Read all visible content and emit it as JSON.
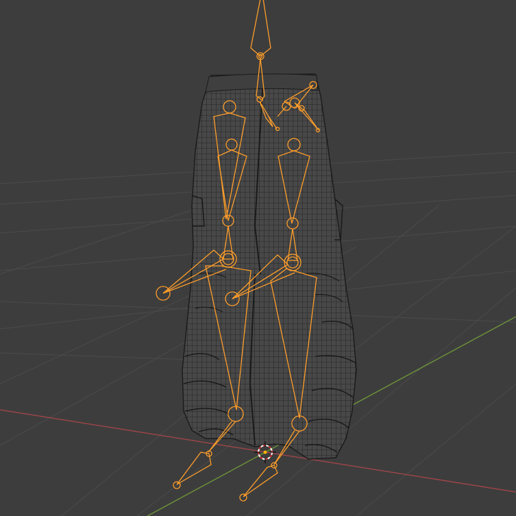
{
  "viewport": {
    "name": "3D Viewport",
    "background_color": "#3d3d3d",
    "grid_color": "#4a4a4a",
    "x_axis_color": "#a14a4f",
    "y_axis_color": "#6a8f3a"
  },
  "scene": {
    "mesh_object": "cargo-pants",
    "mesh_wire_color": "#000000",
    "mesh_fill_color": "#474747",
    "armature_object": "armature",
    "armature_color": "#ff9e2a",
    "cursor_icon": "3d-cursor-icon"
  }
}
